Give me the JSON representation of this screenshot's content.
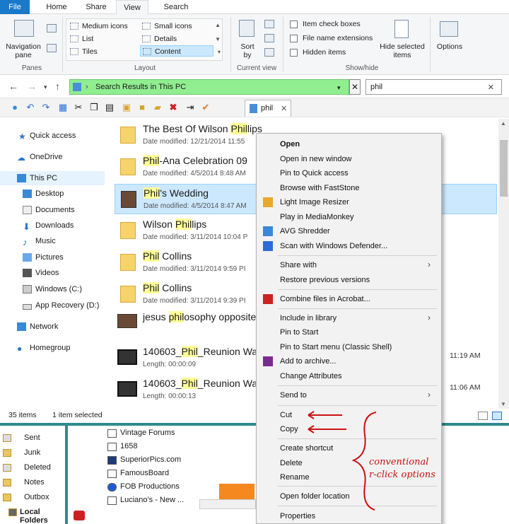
{
  "ribbon": {
    "tabs": [
      "File",
      "Home",
      "Share",
      "View",
      "Search"
    ],
    "panes": {
      "nav_pane": "Navigation pane",
      "label": "Panes"
    },
    "layout": {
      "items": [
        "Medium icons",
        "Small icons",
        "List",
        "Details",
        "Tiles",
        "Content"
      ],
      "selected": "Content",
      "label": "Layout"
    },
    "current_view": {
      "sort": "Sort by",
      "label": "Current view"
    },
    "show_hide": {
      "checks": [
        "Item check boxes",
        "File name extensions",
        "Hidden items"
      ],
      "hide_selected": "Hide selected items",
      "label": "Show/hide"
    },
    "options": "Options"
  },
  "address": {
    "path": "Search Results in This PC",
    "search_value": "phil"
  },
  "search_tab": "phil",
  "nav": {
    "items": [
      "Quick access",
      "OneDrive",
      "This PC",
      "Desktop",
      "Documents",
      "Downloads",
      "Music",
      "Pictures",
      "Videos",
      "Windows (C:)",
      "App Recovery (D:)",
      "Network",
      "Homegroup"
    ],
    "selected": "This PC"
  },
  "files": [
    {
      "pre": "The Best Of Wilson ",
      "hl": "Phil",
      "post": "lips",
      "meta": "Date modified: 12/21/2014 11:55",
      "time": "",
      "kind": "folder"
    },
    {
      "pre": "",
      "hl": "Phil",
      "post": "-Ana Celebration 09",
      "meta": "Date modified: 4/5/2014 8:48 AM",
      "time": "",
      "kind": "folder"
    },
    {
      "pre": "",
      "hl": "Phil",
      "post": "'s Wedding",
      "meta": "Date modified: 4/5/2014 8:47 AM",
      "time": "",
      "kind": "image"
    },
    {
      "pre": "Wilson ",
      "hl": "Phil",
      "post": "lips",
      "meta": "Date modified: 3/11/2014 10:04 P",
      "time": "",
      "kind": "folder"
    },
    {
      "pre": "",
      "hl": "Phil",
      "post": " Collins",
      "meta": "Date modified: 3/11/2014 9:59 PI",
      "time": "",
      "kind": "folder"
    },
    {
      "pre": "",
      "hl": "Phil",
      "post": " Collins",
      "meta": "Date modified: 3/11/2014 9:39 PI",
      "time": "",
      "kind": "folder"
    },
    {
      "pre": "jesus ",
      "hl": "phil",
      "post": "osophy opposite",
      "meta": "",
      "time": "",
      "kind": "image"
    },
    {
      "pre": "140603_",
      "hl": "Phil",
      "post": "_Reunion Wat",
      "meta": "Length: 00:00:09",
      "time": "11:19 AM",
      "kind": "video"
    },
    {
      "pre": "140603_",
      "hl": "Phil",
      "post": "_Reunion Wat",
      "meta": "Length: 00:00:13",
      "time": "11:06 AM",
      "kind": "video"
    }
  ],
  "status": {
    "count": "35 items",
    "selected": "1 item selected"
  },
  "mail": {
    "folders": [
      "Sent",
      "Junk",
      "Deleted",
      "Notes",
      "Outbox",
      "Local Folders"
    ],
    "sites": [
      "Vintage Forums",
      "1658",
      "SuperiorPics.com",
      "FamousBoard",
      "FOB Productions",
      "Luciano's - New ..."
    ]
  },
  "context_menu": {
    "items": [
      "Open",
      "Open in new window",
      "Pin to Quick access",
      "Browse with FastStone",
      "Light Image Resizer",
      "Play in MediaMonkey",
      "AVG Shredder",
      "Scan with Windows Defender...",
      "Share with",
      "Restore previous versions",
      "Combine files in Acrobat...",
      "Include in library",
      "Pin to Start",
      "Pin to Start menu (Classic Shell)",
      "Add to archive...",
      "Change Attributes",
      "Send to",
      "Cut",
      "Copy",
      "Create shortcut",
      "Delete",
      "Rename",
      "Open folder location",
      "Properties"
    ]
  },
  "annotation": {
    "line1": "conventional",
    "line2": "r-click options"
  },
  "colors": {
    "accent": "#1979ca",
    "address_bg": "#90ee90",
    "highlight": "#ffff99",
    "selection": "#cce8ff",
    "annotation": "#cc1111",
    "divider": "#2e8b8b"
  }
}
